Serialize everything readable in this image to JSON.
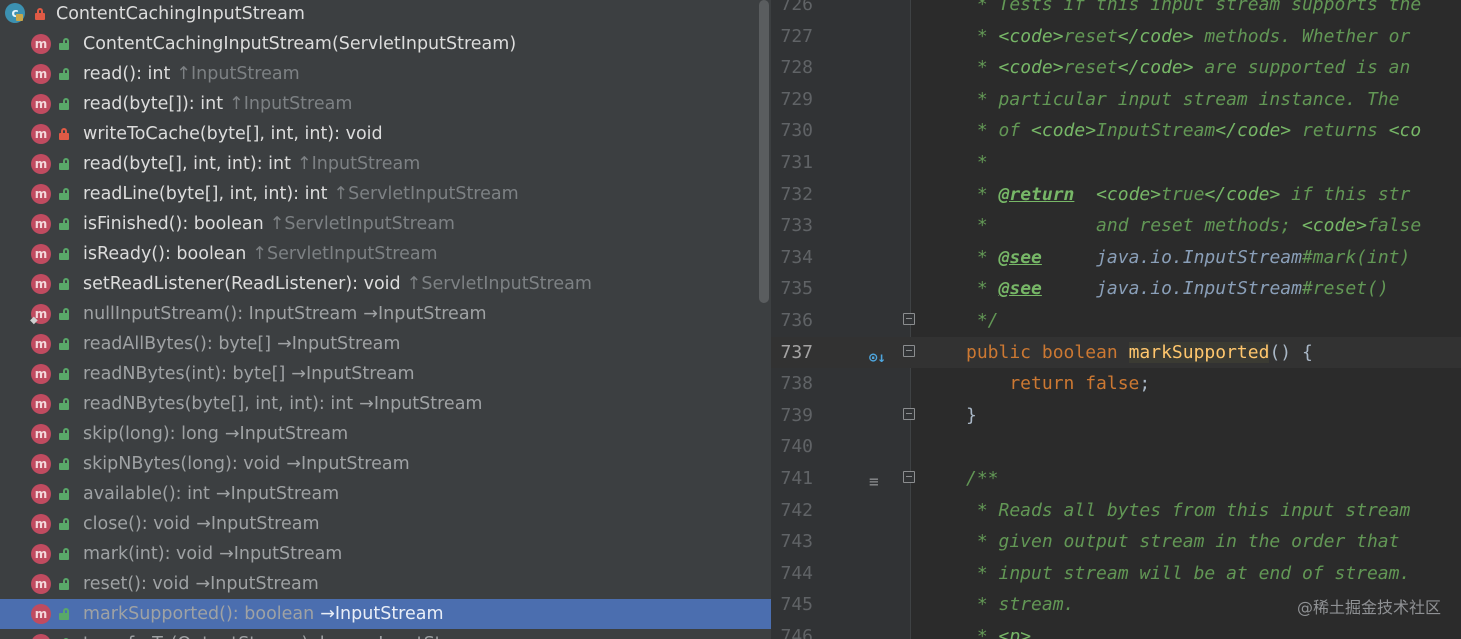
{
  "structure": {
    "class_row": {
      "name": "ContentCachingInputStream"
    },
    "members": [
      {
        "name": "ContentCachingInputStream(ServletInputStream)",
        "location": "",
        "vis": "public",
        "kind": "own"
      },
      {
        "name": "read(): int",
        "location": "↑InputStream",
        "vis": "public",
        "kind": "own"
      },
      {
        "name": "read(byte[]): int",
        "location": "↑InputStream",
        "vis": "public",
        "kind": "own"
      },
      {
        "name": "writeToCache(byte[], int, int): void",
        "location": "",
        "vis": "private",
        "kind": "own"
      },
      {
        "name": "read(byte[], int, int): int",
        "location": "↑InputStream",
        "vis": "public",
        "kind": "own"
      },
      {
        "name": "readLine(byte[], int, int): int",
        "location": "↑ServletInputStream",
        "vis": "public",
        "kind": "own"
      },
      {
        "name": "isFinished(): boolean",
        "location": "↑ServletInputStream",
        "vis": "public",
        "kind": "own"
      },
      {
        "name": "isReady(): boolean",
        "location": "↑ServletInputStream",
        "vis": "public",
        "kind": "own"
      },
      {
        "name": "setReadListener(ReadListener): void",
        "location": "↑ServletInputStream",
        "vis": "public",
        "kind": "own"
      },
      {
        "name": "nullInputStream(): InputStream",
        "location": "→InputStream",
        "vis": "public",
        "kind": "inherited",
        "static": true
      },
      {
        "name": "readAllBytes(): byte[]",
        "location": "→InputStream",
        "vis": "public",
        "kind": "inherited"
      },
      {
        "name": "readNBytes(int): byte[]",
        "location": "→InputStream",
        "vis": "public",
        "kind": "inherited"
      },
      {
        "name": "readNBytes(byte[], int, int): int",
        "location": "→InputStream",
        "vis": "public",
        "kind": "inherited"
      },
      {
        "name": "skip(long): long",
        "location": "→InputStream",
        "vis": "public",
        "kind": "inherited"
      },
      {
        "name": "skipNBytes(long): void",
        "location": "→InputStream",
        "vis": "public",
        "kind": "inherited"
      },
      {
        "name": "available(): int",
        "location": "→InputStream",
        "vis": "public",
        "kind": "inherited"
      },
      {
        "name": "close(): void",
        "location": "→InputStream",
        "vis": "public",
        "kind": "inherited"
      },
      {
        "name": "mark(int): void",
        "location": "→InputStream",
        "vis": "public",
        "kind": "inherited"
      },
      {
        "name": "reset(): void",
        "location": "→InputStream",
        "vis": "public",
        "kind": "inherited"
      },
      {
        "name": "markSupported(): boolean",
        "location": "→InputStream",
        "vis": "public",
        "kind": "inherited",
        "selected": true
      },
      {
        "name": "transferTo(OutputStream): long",
        "location": "→InputStream",
        "vis": "public",
        "kind": "inherited"
      }
    ]
  },
  "editor": {
    "current_line": "737",
    "lines": [
      {
        "num": "726",
        "tokens": [
          [
            "doc",
            " * Tests if this input stream supports the"
          ]
        ]
      },
      {
        "num": "727",
        "tokens": [
          [
            "doc",
            " * "
          ],
          [
            "tag",
            "<code>"
          ],
          [
            "doc",
            "reset"
          ],
          [
            "tag",
            "</code>"
          ],
          [
            "doc",
            " methods. Whether or"
          ]
        ]
      },
      {
        "num": "728",
        "tokens": [
          [
            "doc",
            " * "
          ],
          [
            "tag",
            "<code>"
          ],
          [
            "doc",
            "reset"
          ],
          [
            "tag",
            "</code>"
          ],
          [
            "doc",
            " are supported is an"
          ]
        ]
      },
      {
        "num": "729",
        "tokens": [
          [
            "doc",
            " * particular input stream instance. The"
          ]
        ]
      },
      {
        "num": "730",
        "tokens": [
          [
            "doc",
            " * of "
          ],
          [
            "tag",
            "<code>"
          ],
          [
            "doc",
            "InputStream"
          ],
          [
            "tag",
            "</code>"
          ],
          [
            "doc",
            " returns "
          ],
          [
            "tag",
            "<co"
          ]
        ]
      },
      {
        "num": "731",
        "tokens": [
          [
            "doc",
            " *"
          ]
        ]
      },
      {
        "num": "732",
        "tokens": [
          [
            "doc",
            " * "
          ],
          [
            "tagb",
            "@return"
          ],
          [
            "doc",
            "  "
          ],
          [
            "tag",
            "<code>"
          ],
          [
            "doc",
            "true"
          ],
          [
            "tag",
            "</code>"
          ],
          [
            "doc",
            " if this str"
          ]
        ]
      },
      {
        "num": "733",
        "tokens": [
          [
            "doc",
            " *          and reset methods; "
          ],
          [
            "tag",
            "<code>"
          ],
          [
            "doc",
            "false"
          ]
        ]
      },
      {
        "num": "734",
        "tokens": [
          [
            "doc",
            " * "
          ],
          [
            "tagb",
            "@see"
          ],
          [
            "doc",
            "     "
          ],
          [
            "docref",
            "java.io.InputStream"
          ],
          [
            "doc",
            "#mark(int)"
          ]
        ]
      },
      {
        "num": "735",
        "tokens": [
          [
            "doc",
            " * "
          ],
          [
            "tagb",
            "@see"
          ],
          [
            "doc",
            "     "
          ],
          [
            "docref",
            "java.io.InputStream"
          ],
          [
            "doc",
            "#reset()"
          ]
        ]
      },
      {
        "num": "736",
        "tokens": [
          [
            "doc",
            " */"
          ]
        ],
        "fold": true
      },
      {
        "num": "737",
        "tokens": [
          [
            "kw",
            "public boolean "
          ],
          [
            "fn",
            "markSupported"
          ],
          [
            "plain",
            "() {"
          ]
        ],
        "fold": true,
        "impl": true,
        "current": true
      },
      {
        "num": "738",
        "tokens": [
          [
            "kw",
            "    return false"
          ],
          [
            "plain",
            ";"
          ]
        ]
      },
      {
        "num": "739",
        "tokens": [
          [
            "plain",
            "}"
          ]
        ],
        "fold": true
      },
      {
        "num": "740",
        "tokens": []
      },
      {
        "num": "741",
        "tokens": [
          [
            "doc",
            "/**"
          ]
        ],
        "fold": true,
        "list": true
      },
      {
        "num": "742",
        "tokens": [
          [
            "doc",
            " * Reads all bytes from this input stream"
          ]
        ]
      },
      {
        "num": "743",
        "tokens": [
          [
            "doc",
            " * given output stream in the order that"
          ]
        ]
      },
      {
        "num": "744",
        "tokens": [
          [
            "doc",
            " * input stream will be at end of stream."
          ]
        ]
      },
      {
        "num": "745",
        "tokens": [
          [
            "doc",
            " * stream."
          ]
        ]
      },
      {
        "num": "746",
        "tokens": [
          [
            "doc",
            " * "
          ],
          [
            "tag",
            "<p>"
          ]
        ]
      }
    ]
  },
  "watermark": "@稀土掘金技术社区"
}
